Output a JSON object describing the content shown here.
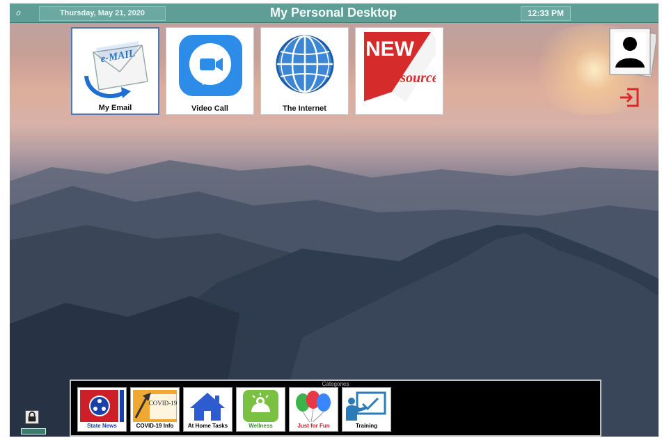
{
  "header": {
    "logo_glyph": "ℴ",
    "date": "Thursday, May 21, 2020",
    "title": "My Personal Desktop",
    "time": "12:33 PM"
  },
  "apps": [
    {
      "label": "My Email",
      "icon": "email-icon",
      "icon_text": "e-MAIL"
    },
    {
      "label": "Video Call",
      "icon": "video-camera-icon"
    },
    {
      "label": "The Internet",
      "icon": "globe-icon"
    },
    {
      "label": "",
      "icon": "new-resources-icon",
      "icon_text_1": "NEW",
      "icon_text_2": "Resources"
    }
  ],
  "sidebar": {
    "profile_icon": "profile-photo-icon",
    "exit_icon": "exit-icon"
  },
  "categories": {
    "title": "Categories",
    "items": [
      {
        "label": "State News",
        "icon": "tennessee-flag-icon",
        "color": "#1a3fa8"
      },
      {
        "label": "COVID-19 Info",
        "icon": "covid-info-icon",
        "icon_text": "COVID-19",
        "color": "#111111"
      },
      {
        "label": "At Home Tasks",
        "icon": "house-icon",
        "color": "#111111"
      },
      {
        "label": "Wellness",
        "icon": "wellness-icon",
        "color": "#3a8c2a"
      },
      {
        "label": "Just for Fun",
        "icon": "balloons-icon",
        "color": "#d42020"
      },
      {
        "label": "Training",
        "icon": "teacher-board-icon",
        "color": "#111111"
      }
    ]
  },
  "footer": {
    "lock_icon": "lock-icon"
  },
  "colors": {
    "header_bg": "#5f9e97",
    "accent_red": "#d62b2b",
    "email_blue": "#2a72c4"
  }
}
